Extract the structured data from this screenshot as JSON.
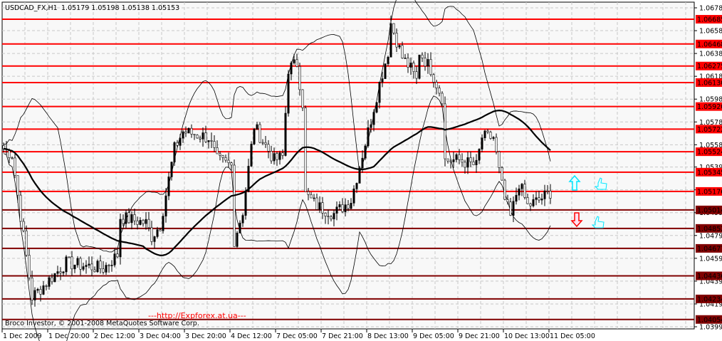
{
  "header": {
    "symbol": "USDCAD_FX,H1",
    "ohlc": "1.05179 1.05198 1.05138 1.05153"
  },
  "footer": {
    "copyright": "Broco Investor, © 2001-2008 MetaQuotes Software Corp.",
    "watermark": "---http://Expforex.at.ua---"
  },
  "colors": {
    "upper_level": "#ff0000",
    "lower_level": "#800000",
    "arrow_up": "#00e5ff",
    "arrow_down": "#ff0000",
    "thumb": "#00e5ff"
  },
  "icons": {
    "buy_signal": "arrow-up-icon",
    "sell_signal": "arrow-down-icon",
    "thumb_up": "thumbs-up-icon"
  },
  "chart_data": {
    "type": "candlestick",
    "title": "USDCAD_FX,H1",
    "ylim": [
      1.0396,
      1.0682
    ],
    "price_ticks": [
      "1.06785",
      "1.06585",
      "1.06385",
      "1.06185",
      "1.05985",
      "1.05785",
      "1.05585",
      "1.05390",
      "1.05190",
      "1.04990",
      "1.04790",
      "1.04590",
      "1.04390",
      "1.04190",
      "1.03990"
    ],
    "time_ticks": [
      "1 Dec 2009",
      "1 Dec 20:00",
      "2 Dec 12:00",
      "3 Dec 04:00",
      "3 Dec 20:00",
      "4 Dec 12:00",
      "7 Dec 05:00",
      "7 Dec 21:00",
      "8 Dec 13:00",
      "9 Dec 05:00",
      "9 Dec 21:00",
      "10 Dec 13:00",
      "11 Dec 05:00"
    ],
    "bars_per_tick": 16,
    "levels": [
      {
        "price": "1.06685",
        "side": "upper"
      },
      {
        "price": "1.06468",
        "side": "upper"
      },
      {
        "price": "1.06275",
        "side": "upper"
      },
      {
        "price": "1.06130",
        "side": "upper"
      },
      {
        "price": "1.05920",
        "side": "upper"
      },
      {
        "price": "1.05722",
        "side": "upper"
      },
      {
        "price": "1.05524",
        "side": "upper"
      },
      {
        "price": "1.05345",
        "side": "upper"
      },
      {
        "price": "1.05176",
        "side": "upper"
      },
      {
        "price": "1.05014",
        "side": "lower"
      },
      {
        "price": "1.04852",
        "side": "lower"
      },
      {
        "price": "1.04677",
        "side": "lower"
      },
      {
        "price": "1.04436",
        "side": "lower"
      },
      {
        "price": "1.04234",
        "side": "lower"
      },
      {
        "price": "1.04054",
        "side": "lower"
      }
    ],
    "close_keypoints": [
      [
        0,
        1.0555
      ],
      [
        3,
        1.055
      ],
      [
        10,
        1.0425
      ],
      [
        16,
        1.044
      ],
      [
        22,
        1.0455
      ],
      [
        35,
        1.045
      ],
      [
        40,
        1.0462
      ],
      [
        41,
        1.0495
      ],
      [
        50,
        1.049
      ],
      [
        52,
        1.0478
      ],
      [
        55,
        1.0488
      ],
      [
        60,
        1.0555
      ],
      [
        63,
        1.057
      ],
      [
        72,
        1.0565
      ],
      [
        75,
        1.0545
      ],
      [
        80,
        1.054
      ],
      [
        81,
        1.0475
      ],
      [
        84,
        1.05
      ],
      [
        88,
        1.0575
      ],
      [
        95,
        1.0545
      ],
      [
        98,
        1.0548
      ],
      [
        100,
        1.0625
      ],
      [
        103,
        1.063
      ],
      [
        105,
        1.0595
      ],
      [
        106,
        1.0515
      ],
      [
        110,
        1.0505
      ],
      [
        116,
        1.0498
      ],
      [
        122,
        1.051
      ],
      [
        125,
        1.054
      ],
      [
        128,
        1.057
      ],
      [
        132,
        1.0612
      ],
      [
        135,
        1.064
      ],
      [
        136,
        1.0665
      ],
      [
        140,
        1.0635
      ],
      [
        143,
        1.0625
      ],
      [
        145,
        1.0615
      ],
      [
        146,
        1.064
      ],
      [
        150,
        1.0625
      ],
      [
        152,
        1.0612
      ],
      [
        154,
        1.06
      ],
      [
        155,
        1.0545
      ],
      [
        160,
        1.0545
      ],
      [
        166,
        1.054
      ],
      [
        168,
        1.0565
      ],
      [
        172,
        1.0565
      ],
      [
        174,
        1.0535
      ],
      [
        176,
        1.051
      ],
      [
        178,
        1.0495
      ],
      [
        181,
        1.0525
      ],
      [
        184,
        1.0505
      ],
      [
        188,
        1.051
      ],
      [
        192,
        1.0517
      ]
    ],
    "indicators": [
      "SMA(50)",
      "Bollinger Bands(20,2)"
    ]
  }
}
